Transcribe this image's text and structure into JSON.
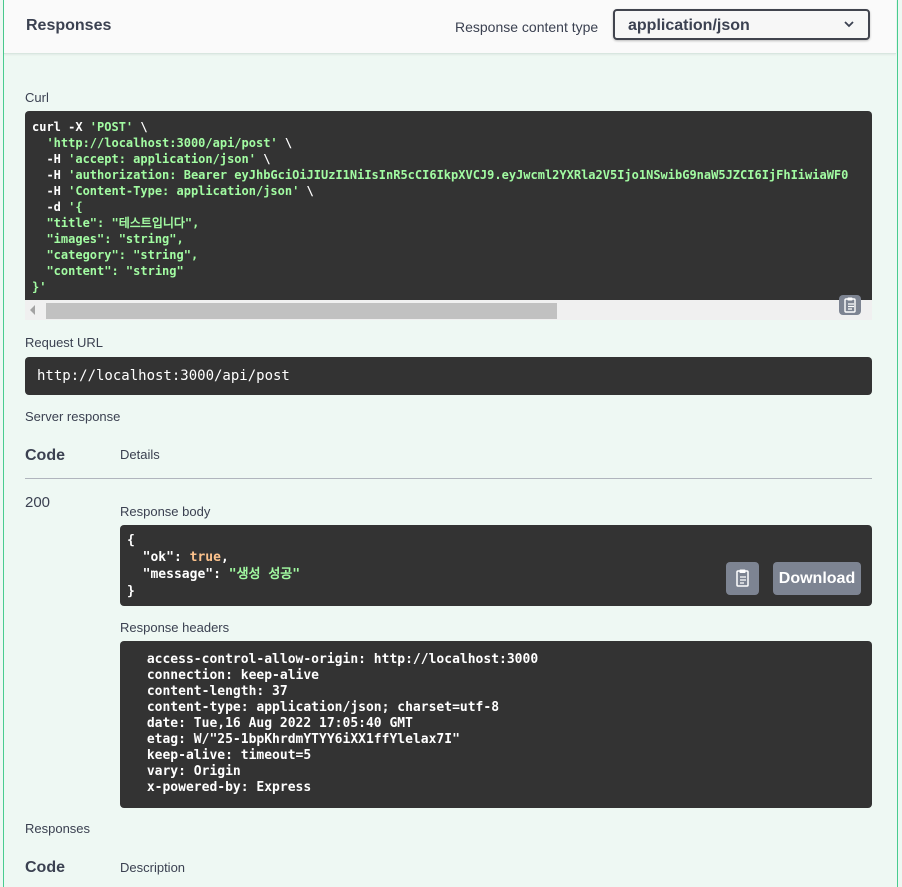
{
  "responses_header": {
    "title": "Responses",
    "content_type_label": "Response content type",
    "content_type_value": "application/json"
  },
  "curl": {
    "label": "Curl",
    "lines": [
      [
        {
          "t": "curl -X ",
          "c": "plain"
        },
        {
          "t": "'POST'",
          "c": "str"
        },
        {
          "t": " \\",
          "c": "plain"
        }
      ],
      [
        {
          "t": "  ",
          "c": "plain"
        },
        {
          "t": "'http://localhost:3000/api/post'",
          "c": "str"
        },
        {
          "t": " \\",
          "c": "plain"
        }
      ],
      [
        {
          "t": "  -H ",
          "c": "plain"
        },
        {
          "t": "'accept: application/json'",
          "c": "str"
        },
        {
          "t": " \\",
          "c": "plain"
        }
      ],
      [
        {
          "t": "  -H ",
          "c": "plain"
        },
        {
          "t": "'authorization: Bearer eyJhbGciOiJIUzI1NiIsInR5cCI6IkpXVCJ9.eyJwcml2YXRla2V5Ijo1NSwibG9naW5JZCI6IjFhIiwiaWF0",
          "c": "str"
        }
      ],
      [
        {
          "t": "  -H ",
          "c": "plain"
        },
        {
          "t": "'Content-Type: application/json'",
          "c": "str"
        },
        {
          "t": " \\",
          "c": "plain"
        }
      ],
      [
        {
          "t": "  -d ",
          "c": "plain"
        },
        {
          "t": "'{",
          "c": "str"
        }
      ],
      [
        {
          "t": "  \"title\": \"테스트입니다\",",
          "c": "str"
        }
      ],
      [
        {
          "t": "  \"images\": \"string\",",
          "c": "str"
        }
      ],
      [
        {
          "t": "  \"category\": \"string\",",
          "c": "str"
        }
      ],
      [
        {
          "t": "  \"content\": \"string\"",
          "c": "str"
        }
      ],
      [
        {
          "t": "}'",
          "c": "str"
        }
      ]
    ]
  },
  "request_url": {
    "label": "Request URL",
    "value": "http://localhost:3000/api/post"
  },
  "server_response": {
    "label": "Server response",
    "code_header": "Code",
    "details_header": "Details",
    "code": "200",
    "body_label": "Response body",
    "body_lines": [
      [
        {
          "t": "{",
          "c": "plain"
        }
      ],
      [
        {
          "t": "  \"ok\"",
          "c": "plain"
        },
        {
          "t": ": ",
          "c": "plain"
        },
        {
          "t": "true",
          "c": "kw"
        },
        {
          "t": ",",
          "c": "plain"
        }
      ],
      [
        {
          "t": "  \"message\"",
          "c": "plain"
        },
        {
          "t": ": ",
          "c": "plain"
        },
        {
          "t": "\"생성 성공\"",
          "c": "str"
        }
      ],
      [
        {
          "t": "}",
          "c": "plain"
        }
      ]
    ],
    "download_label": "Download",
    "headers_label": "Response headers",
    "headers_text": " access-control-allow-origin: http://localhost:3000 \n connection: keep-alive \n content-length: 37 \n content-type: application/json; charset=utf-8 \n date: Tue,16 Aug 2022 17:05:40 GMT \n etag: W/\"25-1bpKhrdmYTYY6iXX1ffYlelax7I\" \n keep-alive: timeout=5 \n vary: Origin \n x-powered-by: Express "
  },
  "responses_section": {
    "label": "Responses",
    "code_header": "Code",
    "description_header": "Description"
  },
  "icons": {
    "copy": "copy-to-clipboard-icon",
    "chevron": "chevron-down-icon"
  }
}
